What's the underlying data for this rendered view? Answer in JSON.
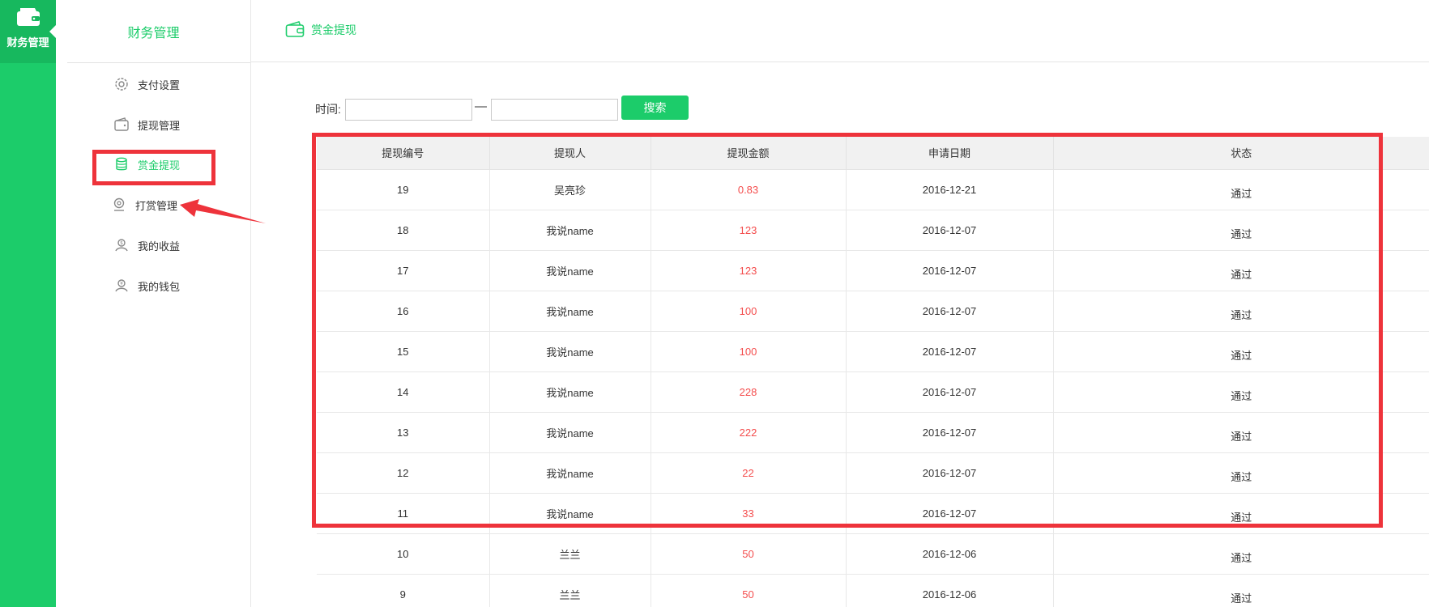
{
  "rail": {
    "active_label": "财务管理",
    "icon": "wallet-icon"
  },
  "submenu": {
    "title": "财务管理",
    "items": [
      {
        "label": "支付设置",
        "icon": "gear-icon",
        "active": false
      },
      {
        "label": "提现管理",
        "icon": "wallet-icon",
        "active": false
      },
      {
        "label": "赏金提现",
        "icon": "coins-icon",
        "active": true
      },
      {
        "label": "打赏管理",
        "icon": "reward-icon",
        "active": false
      },
      {
        "label": "我的收益",
        "icon": "income-icon",
        "active": false
      },
      {
        "label": "我的钱包",
        "icon": "purse-icon",
        "active": false
      }
    ]
  },
  "header": {
    "title": "赏金提现",
    "icon": "wallet-icon"
  },
  "search": {
    "label": "时间:",
    "start_value": "",
    "end_value": "",
    "separator": "—",
    "button_label": "搜索"
  },
  "table": {
    "columns": [
      "提现编号",
      "提现人",
      "提现金额",
      "申请日期",
      "状态"
    ],
    "rows": [
      {
        "id": "19",
        "person": "吴亮珍",
        "amount": "0.83",
        "date": "2016-12-21",
        "status": "通过"
      },
      {
        "id": "18",
        "person": "我说name",
        "amount": "123",
        "date": "2016-12-07",
        "status": "通过"
      },
      {
        "id": "17",
        "person": "我说name",
        "amount": "123",
        "date": "2016-12-07",
        "status": "通过"
      },
      {
        "id": "16",
        "person": "我说name",
        "amount": "100",
        "date": "2016-12-07",
        "status": "通过"
      },
      {
        "id": "15",
        "person": "我说name",
        "amount": "100",
        "date": "2016-12-07",
        "status": "通过"
      },
      {
        "id": "14",
        "person": "我说name",
        "amount": "228",
        "date": "2016-12-07",
        "status": "通过"
      },
      {
        "id": "13",
        "person": "我说name",
        "amount": "222",
        "date": "2016-12-07",
        "status": "通过"
      },
      {
        "id": "12",
        "person": "我说name",
        "amount": "22",
        "date": "2016-12-07",
        "status": "通过"
      },
      {
        "id": "11",
        "person": "我说name",
        "amount": "33",
        "date": "2016-12-07",
        "status": "通过"
      },
      {
        "id": "10",
        "person": "兰兰",
        "amount": "50",
        "date": "2016-12-06",
        "status": "通过"
      },
      {
        "id": "9",
        "person": "兰兰",
        "amount": "50",
        "date": "2016-12-06",
        "status": "通过"
      }
    ]
  },
  "colors": {
    "brand_green": "#1ccc6a",
    "amount_red": "#f44e4e",
    "annotation_red": "#ee333b"
  }
}
